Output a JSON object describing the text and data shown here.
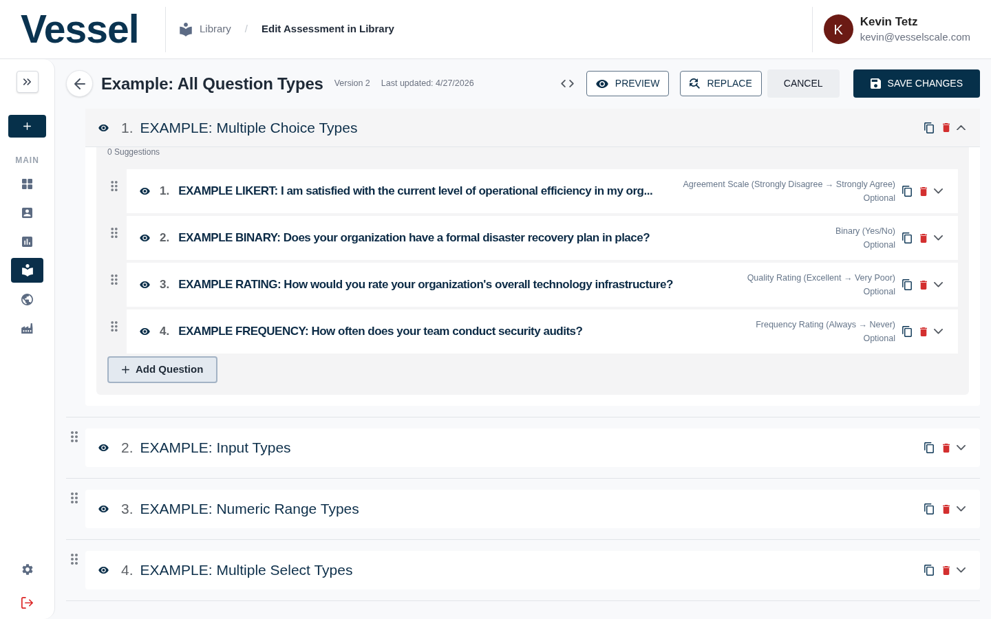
{
  "header": {
    "logo": "Vessel",
    "breadcrumb": {
      "separator": "/",
      "items": [
        {
          "label": "Library",
          "current": false
        },
        {
          "label": "Edit Assessment in Library",
          "current": true
        }
      ]
    },
    "user": {
      "initial": "K",
      "name": "Kevin Tetz",
      "email": "kevin@vesselscale.com"
    }
  },
  "sidebar": {
    "section_label": "MAIN",
    "items": [
      {
        "kind": "grid",
        "selected": false
      },
      {
        "kind": "contact",
        "selected": false
      },
      {
        "kind": "chart",
        "selected": false
      },
      {
        "kind": "library",
        "selected": true
      },
      {
        "kind": "globe",
        "selected": false
      },
      {
        "kind": "factory",
        "selected": false
      }
    ]
  },
  "toolbar": {
    "title": "Example: All Question Types",
    "version": "Version 2",
    "last_updated": "Last updated: 4/27/2026",
    "buttons": [
      {
        "kind": "preview",
        "label": "PREVIEW"
      },
      {
        "kind": "replace",
        "label": "REPLACE"
      },
      {
        "kind": "cancel",
        "label": "CANCEL"
      },
      {
        "kind": "save",
        "label": "SAVE CHANGES"
      }
    ]
  },
  "sections": [
    {
      "number": "1.",
      "title": "EXAMPLE: Multiple Choice Types",
      "expanded": true,
      "suggestions": "0 Suggestions",
      "questions": [
        {
          "number": "1.",
          "text": "EXAMPLE LIKERT: I am satisfied with the current level of operational efficiency in my org...",
          "type": "Agreement Scale (Strongly Disagree → Strongly Agree)",
          "requirement": "Optional"
        },
        {
          "number": "2.",
          "text": "EXAMPLE BINARY: Does your organization have a formal disaster recovery plan in place?",
          "type": "Binary (Yes/No)",
          "requirement": "Optional"
        },
        {
          "number": "3.",
          "text": "EXAMPLE RATING: How would you rate your organization's overall technology infrastructure?",
          "type": "Quality Rating (Excellent → Very Poor)",
          "requirement": "Optional"
        },
        {
          "number": "4.",
          "text": "EXAMPLE FREQUENCY: How often does your team conduct security audits?",
          "type": "Frequency Rating (Always → Never)",
          "requirement": "Optional"
        }
      ],
      "add_label": "Add Question"
    },
    {
      "number": "2.",
      "title": "EXAMPLE: Input Types",
      "expanded": false
    },
    {
      "number": "3.",
      "title": "EXAMPLE: Numeric Range Types",
      "expanded": false
    },
    {
      "number": "4.",
      "title": "EXAMPLE: Multiple Select Types",
      "expanded": false
    }
  ]
}
